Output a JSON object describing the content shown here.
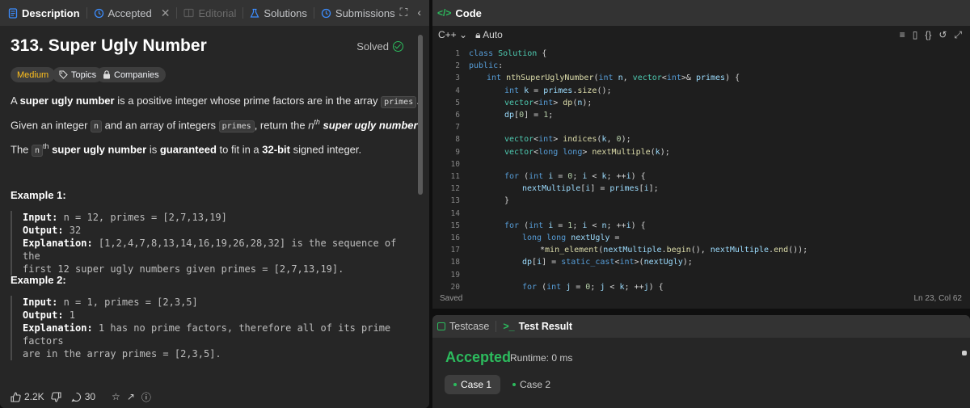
{
  "left_tabs": [
    {
      "label": "Description",
      "active": true
    },
    {
      "label": "Accepted"
    },
    {
      "label": "Editorial",
      "dim": true
    },
    {
      "label": "Solutions"
    },
    {
      "label": "Submissions"
    }
  ],
  "problem": {
    "title": "313. Super Ugly Number",
    "status": "Solved",
    "difficulty": "Medium",
    "topics_label": "Topics",
    "companies_label": "Companies",
    "desc1": {
      "pre": "A ",
      "bold": "super ugly number",
      "mid": " is a positive integer whose prime factors are in the array ",
      "code": "primes",
      "post": "."
    },
    "desc2": {
      "pre": "Given an integer ",
      "code1": "n",
      "mid": " and an array of integers ",
      "code2": "primes",
      "mid2": ", return the ",
      "it": "n",
      "sup": "th",
      "bold": " super ugly number",
      "post": "."
    },
    "desc3": {
      "pre": "The ",
      "code": "n",
      "sup": "th",
      "bold": " super ugly number",
      "mid": " is ",
      "bold2": "guaranteed",
      "mid2": " to fit in a ",
      "bold3": "32-bit",
      "post": " signed integer."
    },
    "examples": [
      {
        "title": "Example 1:",
        "input_label": "Input:",
        "input": " n = 12, primes = [2,7,13,19]",
        "output_label": "Output:",
        "output": " 32",
        "expl_label": "Explanation:",
        "expl1": " [1,2,4,7,8,13,14,16,19,26,28,32] is the sequence of the",
        "expl2": "first 12 super ugly numbers given primes = [2,7,13,19]."
      },
      {
        "title": "Example 2:",
        "input_label": "Input:",
        "input": " n = 1, primes = [2,3,5]",
        "output_label": "Output:",
        "output": " 1",
        "expl_label": "Explanation:",
        "expl1": " 1 has no prime factors, therefore all of its prime factors",
        "expl2": "are in the array primes = [2,3,5]."
      }
    ]
  },
  "footer": {
    "likes": "2.2K",
    "comments": "30"
  },
  "code_panel": {
    "title": "Code",
    "language": "C++",
    "mode": "Auto",
    "saved": "Saved",
    "cursor": "Ln 23, Col 62"
  },
  "code_lines": [
    {
      "n": "1",
      "html": "<span class=\"kw\">class</span> <span class=\"ty\">Solution</span> {",
      "indent": 0
    },
    {
      "n": "2",
      "html": "<span class=\"kw\">public</span>:",
      "indent": 0
    },
    {
      "n": "3",
      "html": "<span class=\"kw\">int</span> <span class=\"fn\">nthSuperUglyNumber</span>(<span class=\"kw\">int</span> <span class=\"vr\">n</span>, <span class=\"ty\">vector</span>&lt;<span class=\"kw\">int</span>&gt;&amp; <span class=\"vr\">primes</span>) {",
      "indent": 1
    },
    {
      "n": "4",
      "html": "<span class=\"kw\">int</span> <span class=\"vr\">k</span> = <span class=\"vr\">primes</span>.<span class=\"fn\">size</span>();",
      "indent": 2
    },
    {
      "n": "5",
      "html": "<span class=\"ty\">vector</span>&lt;<span class=\"kw\">int</span>&gt; <span class=\"fn\">dp</span>(<span class=\"vr\">n</span>);",
      "indent": 2
    },
    {
      "n": "6",
      "html": "<span class=\"vr\">dp</span>[<span class=\"nm\">0</span>] = <span class=\"nm\">1</span>;",
      "indent": 2
    },
    {
      "n": "7",
      "html": "",
      "indent": 2
    },
    {
      "n": "8",
      "html": "<span class=\"ty\">vector</span>&lt;<span class=\"kw\">int</span>&gt; <span class=\"fn\">indices</span>(<span class=\"vr\">k</span>, <span class=\"nm\">0</span>);",
      "indent": 2
    },
    {
      "n": "9",
      "html": "<span class=\"ty\">vector</span>&lt;<span class=\"kw\">long long</span>&gt; <span class=\"fn\">nextMultiple</span>(<span class=\"vr\">k</span>);",
      "indent": 2
    },
    {
      "n": "10",
      "html": "",
      "indent": 2
    },
    {
      "n": "11",
      "html": "<span class=\"kw\">for</span> (<span class=\"kw\">int</span> <span class=\"vr\">i</span> = <span class=\"nm\">0</span>; <span class=\"vr\">i</span> &lt; <span class=\"vr\">k</span>; ++<span class=\"vr\">i</span>) {",
      "indent": 2
    },
    {
      "n": "12",
      "html": "<span class=\"vr\">nextMultiple</span>[<span class=\"vr\">i</span>] = <span class=\"vr\">primes</span>[<span class=\"vr\">i</span>];",
      "indent": 3
    },
    {
      "n": "13",
      "html": "}",
      "indent": 2
    },
    {
      "n": "14",
      "html": "",
      "indent": 2
    },
    {
      "n": "15",
      "html": "<span class=\"kw\">for</span> (<span class=\"kw\">int</span> <span class=\"vr\">i</span> = <span class=\"nm\">1</span>; <span class=\"vr\">i</span> &lt; <span class=\"vr\">n</span>; ++<span class=\"vr\">i</span>) {",
      "indent": 2
    },
    {
      "n": "16",
      "html": "<span class=\"kw\">long long</span> <span class=\"vr\">nextUgly</span> =",
      "indent": 3
    },
    {
      "n": "17",
      "html": "*<span class=\"fn\">min_element</span>(<span class=\"vr\">nextMultiple</span>.<span class=\"fn\">begin</span>(), <span class=\"vr\">nextMultiple</span>.<span class=\"fn\">end</span>());",
      "indent": 4
    },
    {
      "n": "18",
      "html": "<span class=\"vr\">dp</span>[<span class=\"vr\">i</span>] = <span class=\"kw\">static_cast</span>&lt;<span class=\"kw\">int</span>&gt;(<span class=\"vr\">nextUgly</span>);",
      "indent": 3
    },
    {
      "n": "19",
      "html": "",
      "indent": 3
    },
    {
      "n": "20",
      "html": "<span class=\"kw\">for</span> (<span class=\"kw\">int</span> <span class=\"vr\">j</span> = <span class=\"nm\">0</span>; <span class=\"vr\">j</span> &lt; <span class=\"vr\">k</span>; ++<span class=\"vr\">j</span>) {",
      "indent": 3
    }
  ],
  "result_panel": {
    "tab_testcase": "Testcase",
    "tab_result": "Test Result",
    "status": "Accepted",
    "runtime": "Runtime: 0 ms",
    "cases": [
      "Case 1",
      "Case 2"
    ]
  },
  "colors": {
    "accent_green": "#2cbb5d",
    "medium": "#ffc01e",
    "tab_blue": "#3c8dff"
  }
}
